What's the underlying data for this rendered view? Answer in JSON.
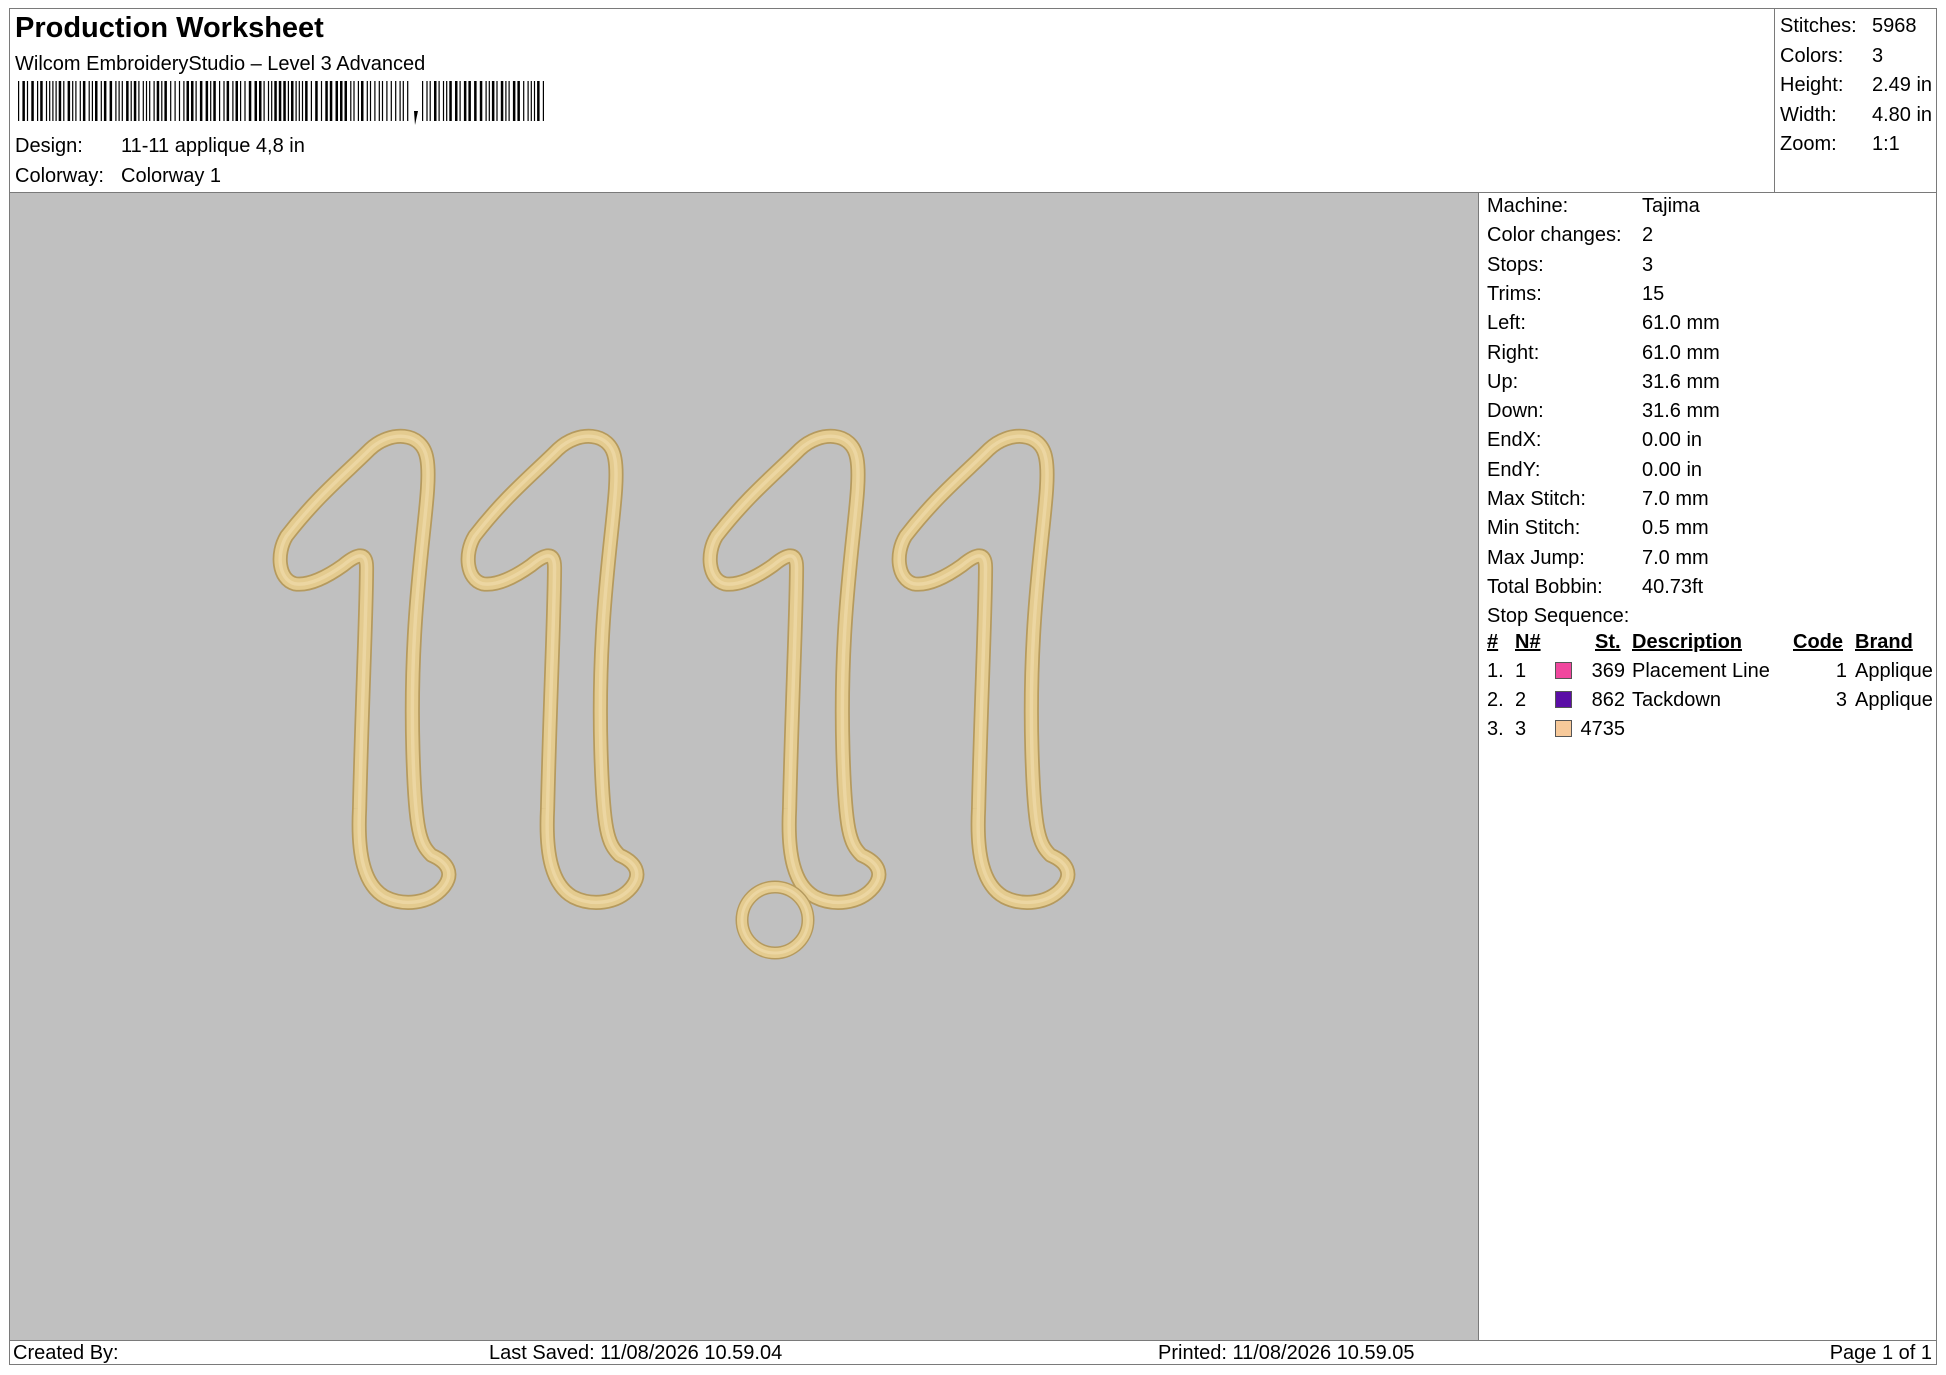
{
  "header": {
    "title": "Production Worksheet",
    "software": "Wilcom EmbroideryStudio – Level 3 Advanced",
    "design_label": "Design:",
    "design_value": "11-11 applique 4,8 in",
    "colorway_label": "Colorway:",
    "colorway_value": "Colorway 1"
  },
  "summary": [
    {
      "label": "Stitches:",
      "value": "5968"
    },
    {
      "label": "Colors:",
      "value": "3"
    },
    {
      "label": "Height:",
      "value": "2.49 in"
    },
    {
      "label": "Width:",
      "value": "4.80 in"
    },
    {
      "label": "Zoom:",
      "value": "1:1"
    }
  ],
  "design": {
    "text": "11.11",
    "thread_color": "#E4CB8F",
    "background_color": "#C0C0C0"
  },
  "info": [
    {
      "label": "Machine:",
      "value": "Tajima"
    },
    {
      "label": "Color changes:",
      "value": "2"
    },
    {
      "label": "Stops:",
      "value": "3"
    },
    {
      "label": "Trims:",
      "value": "15"
    },
    {
      "label": "Left:",
      "value": "61.0 mm"
    },
    {
      "label": "Right:",
      "value": "61.0 mm"
    },
    {
      "label": "Up:",
      "value": "31.6 mm"
    },
    {
      "label": "Down:",
      "value": "31.6 mm"
    },
    {
      "label": "EndX:",
      "value": "0.00 in"
    },
    {
      "label": "EndY:",
      "value": "0.00 in"
    },
    {
      "label": "Max Stitch:",
      "value": "7.0 mm"
    },
    {
      "label": "Min Stitch:",
      "value": "0.5 mm"
    },
    {
      "label": "Max Jump:",
      "value": "7.0 mm"
    },
    {
      "label": "Total Bobbin:",
      "value": "40.73ft"
    },
    {
      "label": "Stop Sequence:",
      "value": ""
    }
  ],
  "stop_sequence": {
    "headers": {
      "num": "#",
      "n": "N#",
      "st": "St.",
      "description": "Description",
      "code": "Code",
      "brand": "Brand"
    },
    "rows": [
      {
        "num": "1.",
        "n": "1",
        "color": "#F0479E",
        "st": "369",
        "description": "Placement Line",
        "code": "1",
        "brand": "Applique"
      },
      {
        "num": "2.",
        "n": "2",
        "color": "#5B0EA6",
        "st": "862",
        "description": "Tackdown",
        "code": "3",
        "brand": "Applique"
      },
      {
        "num": "3.",
        "n": "3",
        "color": "#F7C99A",
        "st": "4735",
        "description": "",
        "code": "",
        "brand": ""
      }
    ]
  },
  "footer": {
    "created_by": "Created By:",
    "last_saved": "Last Saved: 11/08/2026 10.59.04",
    "printed": "Printed: 11/08/2026 10.59.05",
    "page": "Page 1 of 1"
  }
}
